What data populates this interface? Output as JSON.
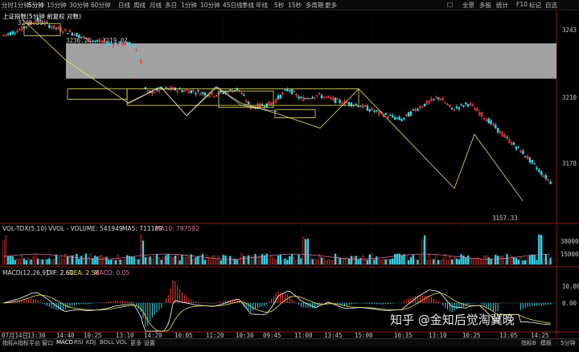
{
  "toolbar": {
    "periods": [
      "分时",
      "1分钟",
      "5分钟",
      "15分钟",
      "30分钟",
      "60分钟",
      "日线",
      "周线",
      "月线",
      "多日",
      "1分钟",
      "10分钟",
      "45日线",
      "季线",
      "年线",
      "5秒",
      "15秒",
      "多周期",
      "更多"
    ],
    "active_period_index": 2,
    "right_items": [
      "□",
      "全景",
      "多股",
      "统计",
      "F10",
      "标记",
      "自选"
    ]
  },
  "chart_title": "上证指数(5分钟 前复权 对数)",
  "annotations": {
    "high": "3248.39",
    "range": "3236.24 - 3219.02",
    "low": "3157.33"
  },
  "price_axis": {
    "ticks": [
      "3243",
      "3210",
      "3178"
    ],
    "tick_values": [
      3243,
      3210,
      3178
    ]
  },
  "volume_pane": {
    "title": "VOL-TDX(5,10)",
    "vvol_label": "VVOL - VOLUME: 541949",
    "ma5_label": "MA5: 711189",
    "ma10_label": "MA10: 787592",
    "ticks": [
      "38000",
      "15000"
    ]
  },
  "macd_pane": {
    "title": "MACD(12,26,9)",
    "dif_label": "DIF: 2.61",
    "dea_label": "DEA: 2.58",
    "macd_label": "MACD: 0.05",
    "ticks": [
      "10.00",
      "0.00"
    ]
  },
  "time_axis": [
    "07月14日",
    "13:30",
    "14:40",
    "10:25",
    "13:10",
    "14:20",
    "10:05",
    "11:20",
    "10:30",
    "09:45",
    "11:00",
    "13:45",
    "15:00",
    "10:35",
    "13:10",
    "10:25",
    "13:05",
    "14:25"
  ],
  "bottom_tabs": [
    "指标A",
    "指标平台",
    "窗口",
    "MACD",
    "RSI",
    "KDJ",
    "BOLL",
    "VOL",
    "更多",
    "设置"
  ],
  "bottom_right": [
    "指标B",
    "模板",
    "5分钟"
  ],
  "watermark": "知乎 @金知后觉淘冀晚",
  "colors": {
    "up": "#ff3b3b",
    "down": "#2fd7e8",
    "box": "#e6e65a",
    "trend": "#e6e65a",
    "zone": "#bdbdbd",
    "dif": "#ffffff",
    "dea": "#e6e65a"
  }
}
